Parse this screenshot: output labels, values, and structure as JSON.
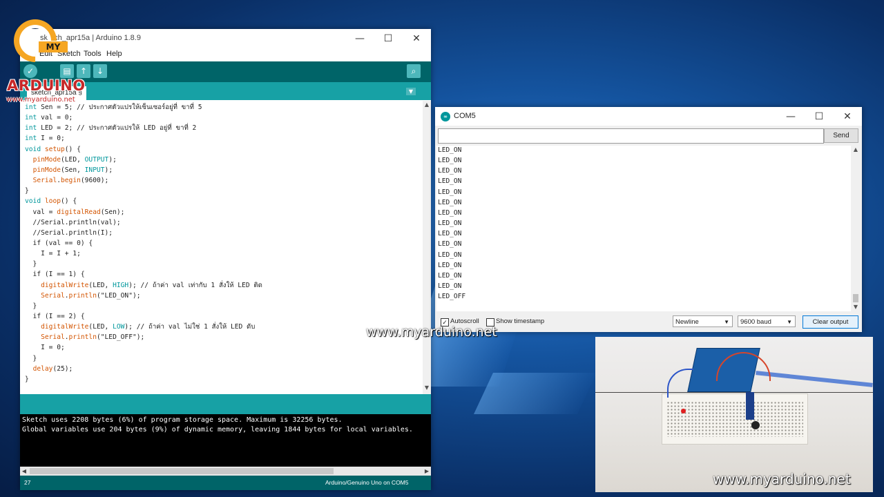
{
  "ide": {
    "title": "sketch_apr15a | Arduino 1.8.9",
    "menu": [
      "Edit",
      "Sketch",
      "Tools",
      "Help"
    ],
    "tab_label": "sketch_apr15a §",
    "code_lines": [
      "int Sen = 5; // ประกาศตัวแปรให้เซ็นเซอร์อยู่ที่ ขาที่ 5",
      "int val = 0;",
      "int LED = 2; // ประกาศตัวแปรให้ LED อยู่ที่ ขาที่ 2",
      "int I = 0;",
      "void setup() {",
      "  pinMode(LED, OUTPUT);",
      "  pinMode(Sen, INPUT);",
      "  Serial.begin(9600);",
      "}",
      "void loop() {",
      "  val = digitalRead(Sen);",
      "  //Serial.println(val);",
      "  //Serial.println(I);",
      "  if (val == 0) {",
      "    I = I + 1;",
      "  }",
      "  if (I == 1) {",
      "    digitalWrite(LED, HIGH); // ถ้าค่า val เท่ากับ 1 สั่งให้ LED ติด",
      "    Serial.println(\"LED_ON\");",
      "  }",
      "  if (I == 2) {",
      "    digitalWrite(LED, LOW); // ถ้าค่า val ไม่ใช่ 1 สั่งให้ LED ดับ",
      "    Serial.println(\"LED_OFF\");",
      "    I = 0;",
      "  }",
      "  delay(25);",
      "}"
    ],
    "console_lines": [
      "Sketch uses 2208 bytes (6%) of program storage space. Maximum is 32256 bytes.",
      "Global variables use 204 bytes (9%) of dynamic memory, leaving 1844 bytes for local variables."
    ],
    "status_line": "27",
    "status_board": "Arduino/Genuino Uno on COM5"
  },
  "logo": {
    "my": "MY",
    "brand": "ARDUINO",
    "url": "www.myarduino.net"
  },
  "serial": {
    "title": "COM5",
    "input_value": "",
    "send_label": "Send",
    "output_lines": [
      "LED_ON",
      "LED_ON",
      "LED_ON",
      "LED_ON",
      "LED_ON",
      "LED_ON",
      "LED_ON",
      "LED_ON",
      "LED_ON",
      "LED_ON",
      "LED_ON",
      "LED_ON",
      "LED_ON",
      "LED_ON",
      "LED_OFF"
    ],
    "autoscroll_label": "Autoscroll",
    "autoscroll_checked": true,
    "timestamp_label": "Show timestamp",
    "timestamp_checked": false,
    "line_ending": "Newline",
    "baud": "9600 baud",
    "clear_label": "Clear output"
  },
  "watermarks": {
    "center": "www.myarduino.net",
    "photo": "www.myarduino.net"
  },
  "colors": {
    "ide_teal_dark": "#006468",
    "ide_teal": "#17a1a5",
    "code_keyword": "#00979c",
    "code_function": "#d35400"
  }
}
